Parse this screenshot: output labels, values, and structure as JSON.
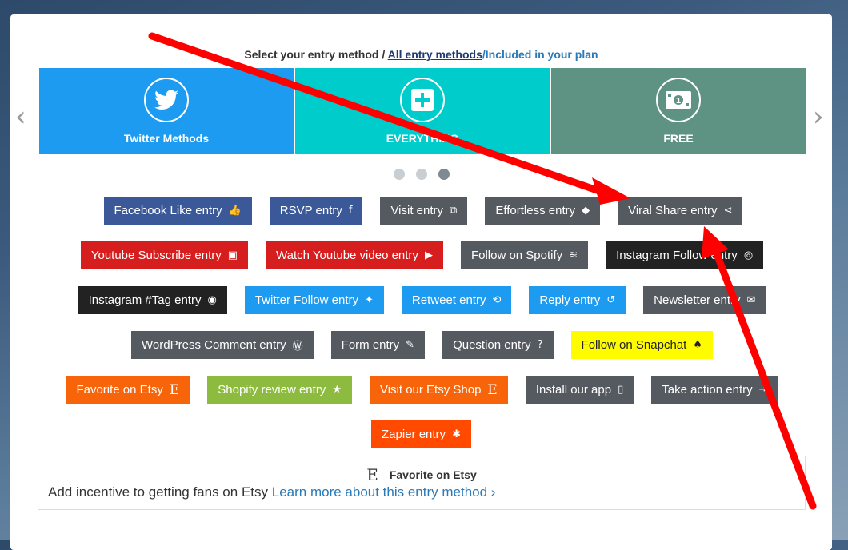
{
  "header": {
    "prefix": "Select your entry method /",
    "all_link": "All entry methods",
    "plan": "/Included in your plan"
  },
  "carousel": {
    "slides": [
      {
        "label": "Twitter Methods",
        "icon": "twitter-bird-icon",
        "color": "#1d9bf0"
      },
      {
        "label": "EVERYTHING",
        "icon": "plus-icon",
        "color": "#00cccc"
      },
      {
        "label": "FREE",
        "icon": "dollar-bill-icon",
        "color": "#5e9283"
      }
    ],
    "prev": "‹",
    "next": "›",
    "active_dot": 3
  },
  "buttons": {
    "row1": [
      {
        "label": "Facebook Like entry",
        "icon": "👍"
      },
      {
        "label": "RSVP entry",
        "icon": "f"
      },
      {
        "label": "Visit entry",
        "icon": "⧉"
      },
      {
        "label": "Effortless entry",
        "icon": "◆"
      },
      {
        "label": "Viral Share entry",
        "icon": "⋖"
      }
    ],
    "row2": [
      {
        "label": "Youtube Subscribe entry",
        "icon": "▣"
      },
      {
        "label": "Watch Youtube video entry",
        "icon": "▶"
      },
      {
        "label": "Follow on Spotify",
        "icon": "≋"
      },
      {
        "label": "Instagram Follow entry",
        "icon": "◎"
      }
    ],
    "row3": [
      {
        "label": "Instagram #Tag entry",
        "icon": "◉"
      },
      {
        "label": "Twitter Follow entry",
        "icon": "✦"
      },
      {
        "label": "Retweet entry",
        "icon": "⟲"
      },
      {
        "label": "Reply entry",
        "icon": "↺"
      },
      {
        "label": "Newsletter entry",
        "icon": "✉"
      }
    ],
    "row4": [
      {
        "label": "WordPress Comment entry",
        "icon": "Ⓦ"
      },
      {
        "label": "Form entry",
        "icon": "✎"
      },
      {
        "label": "Question entry",
        "icon": "?"
      },
      {
        "label": "Follow on Snapchat",
        "icon": "♠"
      }
    ],
    "row5": [
      {
        "label": "Favorite on Etsy",
        "icon": "E"
      },
      {
        "label": "Shopify review entry",
        "icon": "★"
      },
      {
        "label": "Visit our Etsy Shop",
        "icon": "E"
      },
      {
        "label": "Install our app",
        "icon": "▯"
      },
      {
        "label": "Take action entry",
        "icon": "⇥"
      }
    ],
    "row6": [
      {
        "label": "Zapier entry",
        "icon": "✱"
      }
    ]
  },
  "info": {
    "icon": "E",
    "title": "Favorite on Etsy",
    "description": "Add incentive to getting fans on Etsy",
    "link": "Learn more about this entry method ›"
  },
  "colors": {
    "annotation_arrow": "#ff0000"
  }
}
